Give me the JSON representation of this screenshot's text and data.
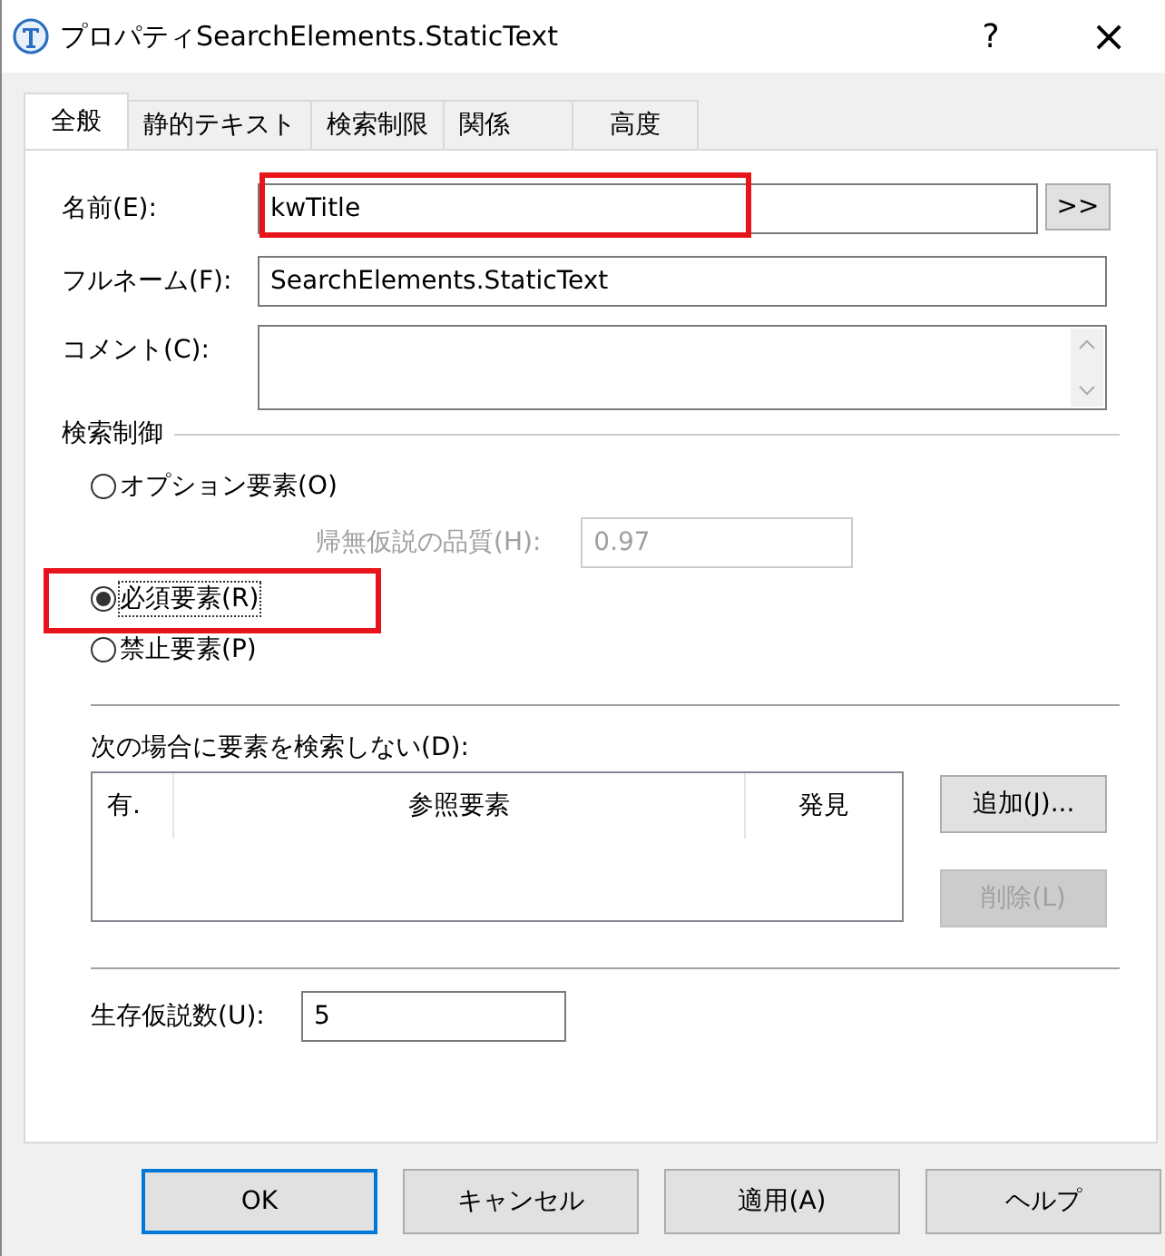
{
  "window": {
    "title": "プロパティSearchElements.StaticText",
    "help": "?",
    "close": "×"
  },
  "tabs": [
    {
      "label": "全般",
      "selected": true
    },
    {
      "label": "静的テキスト",
      "selected": false
    },
    {
      "label": "検索制限",
      "selected": false
    },
    {
      "label": "関係",
      "selected": false
    },
    {
      "label": "高度",
      "selected": false
    }
  ],
  "name": {
    "label": "名前(E):",
    "value": "kwTitle",
    "highlighted": true,
    "button": ">>"
  },
  "full_name": {
    "label": "フルネーム(F):",
    "value": "SearchElements.StaticText"
  },
  "comment": {
    "label": "コメント(C):"
  },
  "search_control": {
    "label": "検索制御",
    "options": [
      {
        "label": "オプション要素(O)",
        "selected": false,
        "highlighted": false
      },
      {
        "label": "必須要素(R)",
        "selected": true,
        "highlighted": true
      },
      {
        "label": "禁止要素(P)",
        "selected": false,
        "highlighted": false
      }
    ],
    "quality": {
      "label": "帰無仮説の品質(H):",
      "value": "0.97",
      "disabled": true
    }
  },
  "exclusions": {
    "label": "次の場合に要素を検索しない(D):",
    "columns": [
      "有.",
      "参照要素",
      "発見"
    ],
    "buttons": [
      {
        "label": "追加(J)...",
        "disabled": false
      },
      {
        "label": "削除(L)",
        "disabled": true
      }
    ]
  },
  "survivors": {
    "label": "生存仮説数(U):",
    "value": "5"
  },
  "buttons": [
    {
      "label": "OK",
      "default": true
    },
    {
      "label": "キャンセル",
      "default": false
    },
    {
      "label": "適用(A)",
      "default": false
    },
    {
      "label": "ヘルプ",
      "default": false
    }
  ]
}
